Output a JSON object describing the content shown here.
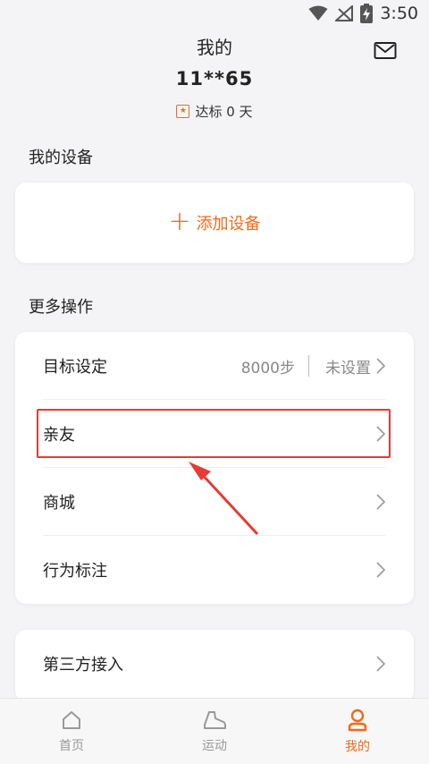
{
  "status_bar": {
    "time": "3:50"
  },
  "header": {
    "title": "我的",
    "user_id": "11**65",
    "goal_badge": "达标 0 天"
  },
  "my_devices": {
    "section_title": "我的设备",
    "add_device_label": "添加设备"
  },
  "more_actions": {
    "section_title": "更多操作",
    "items": [
      {
        "label": "目标设定",
        "value": "8000步",
        "status": "未设置"
      },
      {
        "label": "亲友"
      },
      {
        "label": "商城"
      },
      {
        "label": "行为标注"
      }
    ]
  },
  "third_party": {
    "label": "第三方接入"
  },
  "tab_bar": {
    "tabs": [
      {
        "label": "首页",
        "icon": "home-icon"
      },
      {
        "label": "运动",
        "icon": "sneaker-icon"
      },
      {
        "label": "我的",
        "icon": "person-icon"
      }
    ]
  },
  "colors": {
    "accent": "#f06a19",
    "highlight": "#e53b34"
  }
}
